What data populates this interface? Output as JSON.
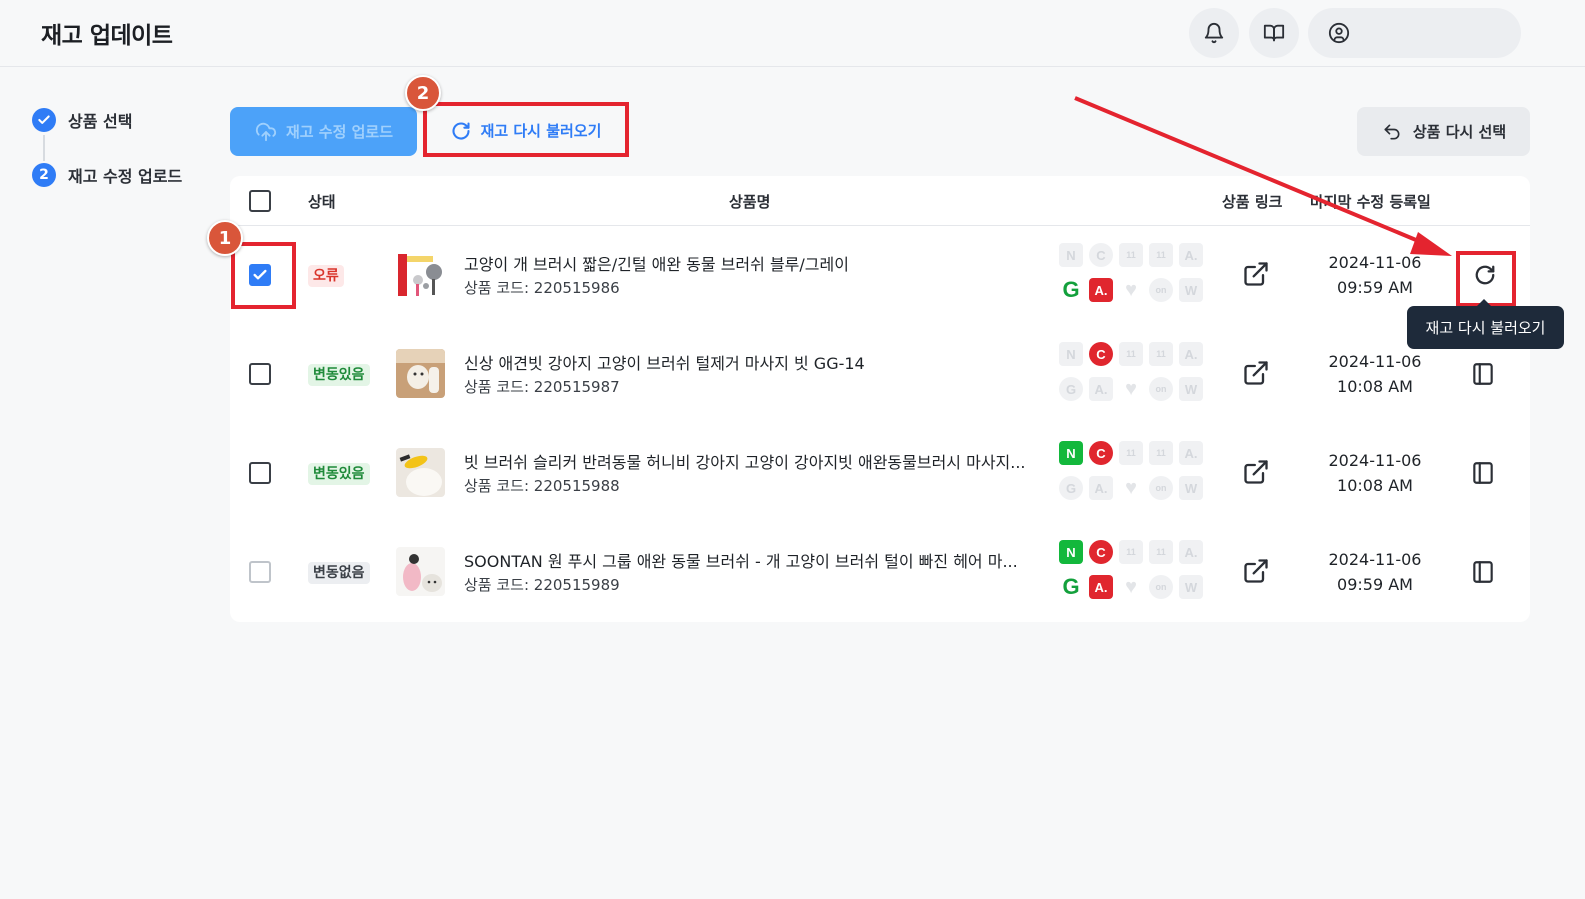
{
  "header": {
    "title": "재고 업데이트",
    "icons": [
      "bell-icon",
      "book-icon",
      "user-circle-icon"
    ]
  },
  "stepper": {
    "steps": [
      {
        "label": "상품 선택",
        "state": "done"
      },
      {
        "label": "재고 수정 업로드",
        "state": "current",
        "number": "2"
      }
    ]
  },
  "toolbar": {
    "upload_label": "재고 수정 업로드",
    "reload_label": "재고 다시 불러오기",
    "reselect_label": "상품 다시 선택"
  },
  "table": {
    "columns": {
      "status": "상태",
      "name": "상품명",
      "link": "상품 링크",
      "date": "마지막 수정 등록일"
    },
    "rows": [
      {
        "checked": true,
        "status": "오류",
        "status_type": "error",
        "name": "고양이 개 브러시 짧은/긴털 애완 동물 브러쉬 블루/그레이",
        "code": "상품 코드: 220515986",
        "date": "2024-11-06",
        "time": "09:59 AM",
        "action": "refresh-icon",
        "markets_active": [
          "gmarket",
          "auction"
        ]
      },
      {
        "checked": false,
        "status": "변동있음",
        "status_type": "changed",
        "name": "신상 애견빗 강아지 고양이 브러쉬 털제거 마사지 빗 GG-14",
        "code": "상품 코드: 220515987",
        "date": "2024-11-06",
        "time": "10:08 AM",
        "action": "panel-icon",
        "markets_active": [
          "coupang"
        ]
      },
      {
        "checked": false,
        "status": "변동있음",
        "status_type": "changed",
        "name": "빗 브러쉬 슬리커 반려동물 허니비 강아지 고양이 강아지빗 애완동물브러시 마사지...",
        "code": "상품 코드: 220515988",
        "date": "2024-11-06",
        "time": "10:08 AM",
        "action": "panel-icon",
        "markets_active": [
          "naver",
          "coupang"
        ]
      },
      {
        "checked": false,
        "status": "변동없음",
        "status_type": "nochange",
        "name": "SOONTAN 원 푸시 그룹 애완 동물 브러쉬 - 개 고양이 브러쉬 털이 빠진 헤어 마...",
        "code": "상품 코드: 220515989",
        "date": "2024-11-06",
        "time": "09:59 AM",
        "action": "panel-icon",
        "markets_active": [
          "naver",
          "coupang",
          "gmarket",
          "auction"
        ]
      }
    ]
  },
  "market_icons": {
    "top": [
      "N",
      "C",
      "11",
      "11",
      "A."
    ],
    "bottom": [
      "G",
      "A.",
      "heart",
      "on",
      "W"
    ]
  },
  "annotations": {
    "badge_1": "1",
    "badge_2": "2",
    "tooltip": "재고 다시 불러오기"
  },
  "colors": {
    "primary": "#2f7cf6",
    "error": "#d9342b",
    "changed": "#1f8a3a",
    "annotation_red": "#e4242f"
  }
}
